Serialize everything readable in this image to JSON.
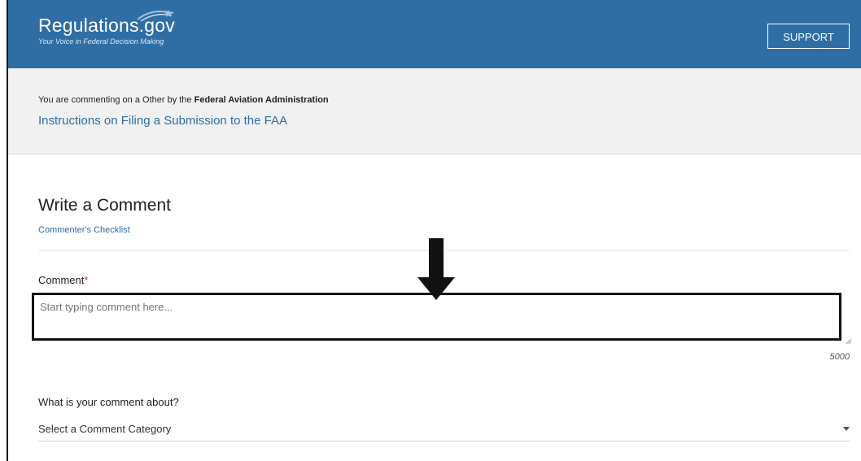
{
  "header": {
    "logo_title": "Regulations.gov",
    "logo_tagline": "Your Voice in Federal Decision Making",
    "support_label": "SUPPORT",
    "brand_color": "#2f6ea5"
  },
  "banner": {
    "prefix": "You are commenting on a Other by the ",
    "agency": "Federal Aviation Administration",
    "document_link": "Instructions on Filing a Submission to the FAA"
  },
  "form": {
    "title": "Write a Comment",
    "checklist_link": "Commenter's Checklist",
    "comment_label": "Comment",
    "required_marker": "*",
    "comment_placeholder": "Start typing comment here...",
    "char_remaining": "5000",
    "about_label": "What is your comment about?",
    "category_selected": "Select a Comment Category"
  },
  "annotation": {
    "arrow_icon": "down-arrow-icon",
    "highlight_color": "#111111"
  }
}
